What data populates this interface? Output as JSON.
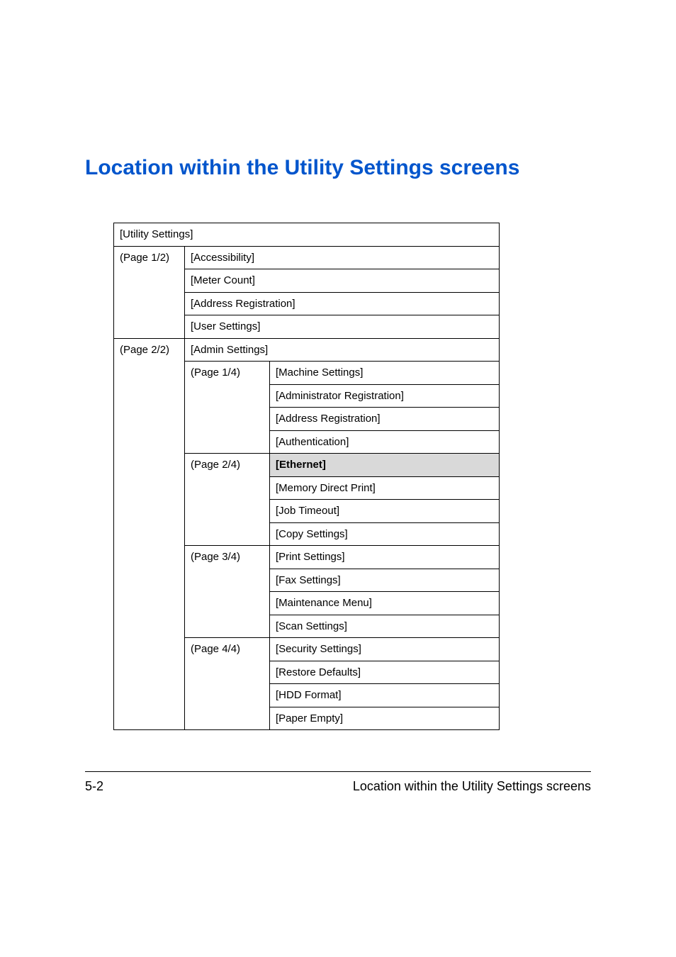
{
  "heading": "Location within the Utility Settings screens",
  "chart_data": {
    "type": "table",
    "title": "Utility Settings navigation tree",
    "root": "[Utility Settings]",
    "levels": [
      {
        "page": "(Page 1/2)",
        "items": [
          "[Accessibility]",
          "[Meter Count]",
          "[Address Registration]",
          "[User Settings]"
        ]
      },
      {
        "page": "(Page 2/2)",
        "items": [
          "[Admin Settings]"
        ],
        "sub": [
          {
            "page": "(Page 1/4)",
            "items": [
              "[Machine Settings]",
              "[Administrator Registration]",
              "[Address Registration]",
              "[Authentication]"
            ]
          },
          {
            "page": "(Page 2/4)",
            "items": [
              "[Ethernet]",
              "[Memory Direct Print]",
              "[Job Timeout]",
              "[Copy Settings]"
            ],
            "highlight": "[Ethernet]"
          },
          {
            "page": "(Page 3/4)",
            "items": [
              "[Print Settings]",
              "[Fax Settings]",
              "[Maintenance Menu]",
              "[Scan Settings]"
            ]
          },
          {
            "page": "(Page 4/4)",
            "items": [
              "[Security Settings]",
              "[Restore Defaults]",
              "[HDD Format]",
              "[Paper Empty]"
            ]
          }
        ]
      }
    ]
  },
  "table": {
    "root": "[Utility Settings]",
    "p12": "(Page 1/2)",
    "accessibility": "[Accessibility]",
    "meter": "[Meter Count]",
    "addrreg1": "[Address Registration]",
    "usersettings": "[User Settings]",
    "p22": "(Page 2/2)",
    "admin": "[Admin Settings]",
    "p14": "(Page 1/4)",
    "machine": "[Machine Settings]",
    "adminreg": "[Administrator Registration]",
    "addrreg2": "[Address Registration]",
    "auth": "[Authentication]",
    "p24": "(Page 2/4)",
    "ethernet": "[Ethernet]",
    "memdirect": "[Memory Direct Print]",
    "jobtimeout": "[Job Timeout]",
    "copy": "[Copy Settings]",
    "p34": "(Page 3/4)",
    "print": "[Print Settings]",
    "fax": "[Fax Settings]",
    "maint": "[Maintenance Menu]",
    "scan": "[Scan Settings]",
    "p44": "(Page 4/4)",
    "security": "[Security Settings]",
    "restore": "[Restore Defaults]",
    "hdd": "[HDD Format]",
    "paper": "[Paper Empty]"
  },
  "footer": {
    "pagenum": "5-2",
    "title": "Location within the Utility Settings screens"
  }
}
